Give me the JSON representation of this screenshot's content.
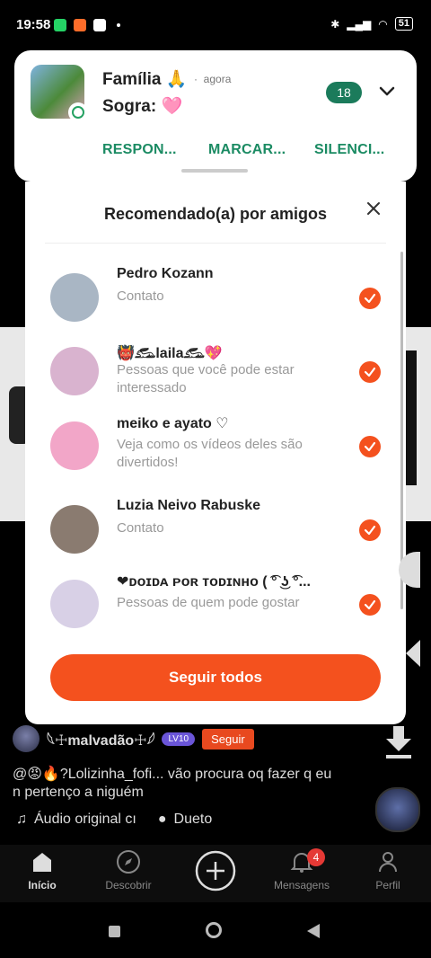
{
  "status_bar": {
    "time": "19:58",
    "battery": "51",
    "app_icon_colors": [
      "#25D366",
      "#FF6D2A",
      "#FFFFFF"
    ]
  },
  "notification": {
    "title": "Família 🙏",
    "time": "agora",
    "body": "Sogra: 🩷",
    "count": "18",
    "actions": [
      "RESPON...",
      "MARCAR...",
      "SILENCI..."
    ]
  },
  "modal": {
    "title": "Recomendado(a) por amigos",
    "rows": [
      {
        "name": "Pedro Kozann",
        "subtitle": "Contato",
        "avatar_color": "#a9b6c4"
      },
      {
        "name": "👹𓃹laila𓃹💖",
        "subtitle": "Pessoas que você pode estar interessado",
        "avatar_color": "#d9b3cf"
      },
      {
        "name": "meiko e ayato ♡",
        "subtitle": "Veja como os vídeos deles são divertidos!",
        "avatar_color": "#f2a6c8"
      },
      {
        "name": "Luzia Neivo Rabuske",
        "subtitle": "Contato",
        "avatar_color": "#8a7b70"
      },
      {
        "name": "❤ᴅᴏɪᴅᴀ ᴘᴏʀ ᴛᴏᴅɪɴʜᴏ ( ͡° ͜ʖ ͡°...",
        "subtitle": "Pessoas de quem pode gostar",
        "avatar_color": "#d8d0e6"
      }
    ],
    "follow_all": "Seguir todos"
  },
  "video": {
    "author": "𓆩☩malvadão☩𓆪",
    "level": "LV10",
    "follow": "Seguir",
    "caption": "@😡🔥?Lolizinha_fofi... vão procura oq fazer q eu n pertenço a niguém",
    "sound": "Áudio original cı",
    "duet": "Dueto"
  },
  "bottom_nav": {
    "items": [
      "Início",
      "Descobrir",
      "",
      "Mensagens",
      "Perfil"
    ],
    "messages_badge": "4"
  },
  "colors": {
    "accent": "#F4511E",
    "whatsapp_green": "#1B8B63"
  }
}
